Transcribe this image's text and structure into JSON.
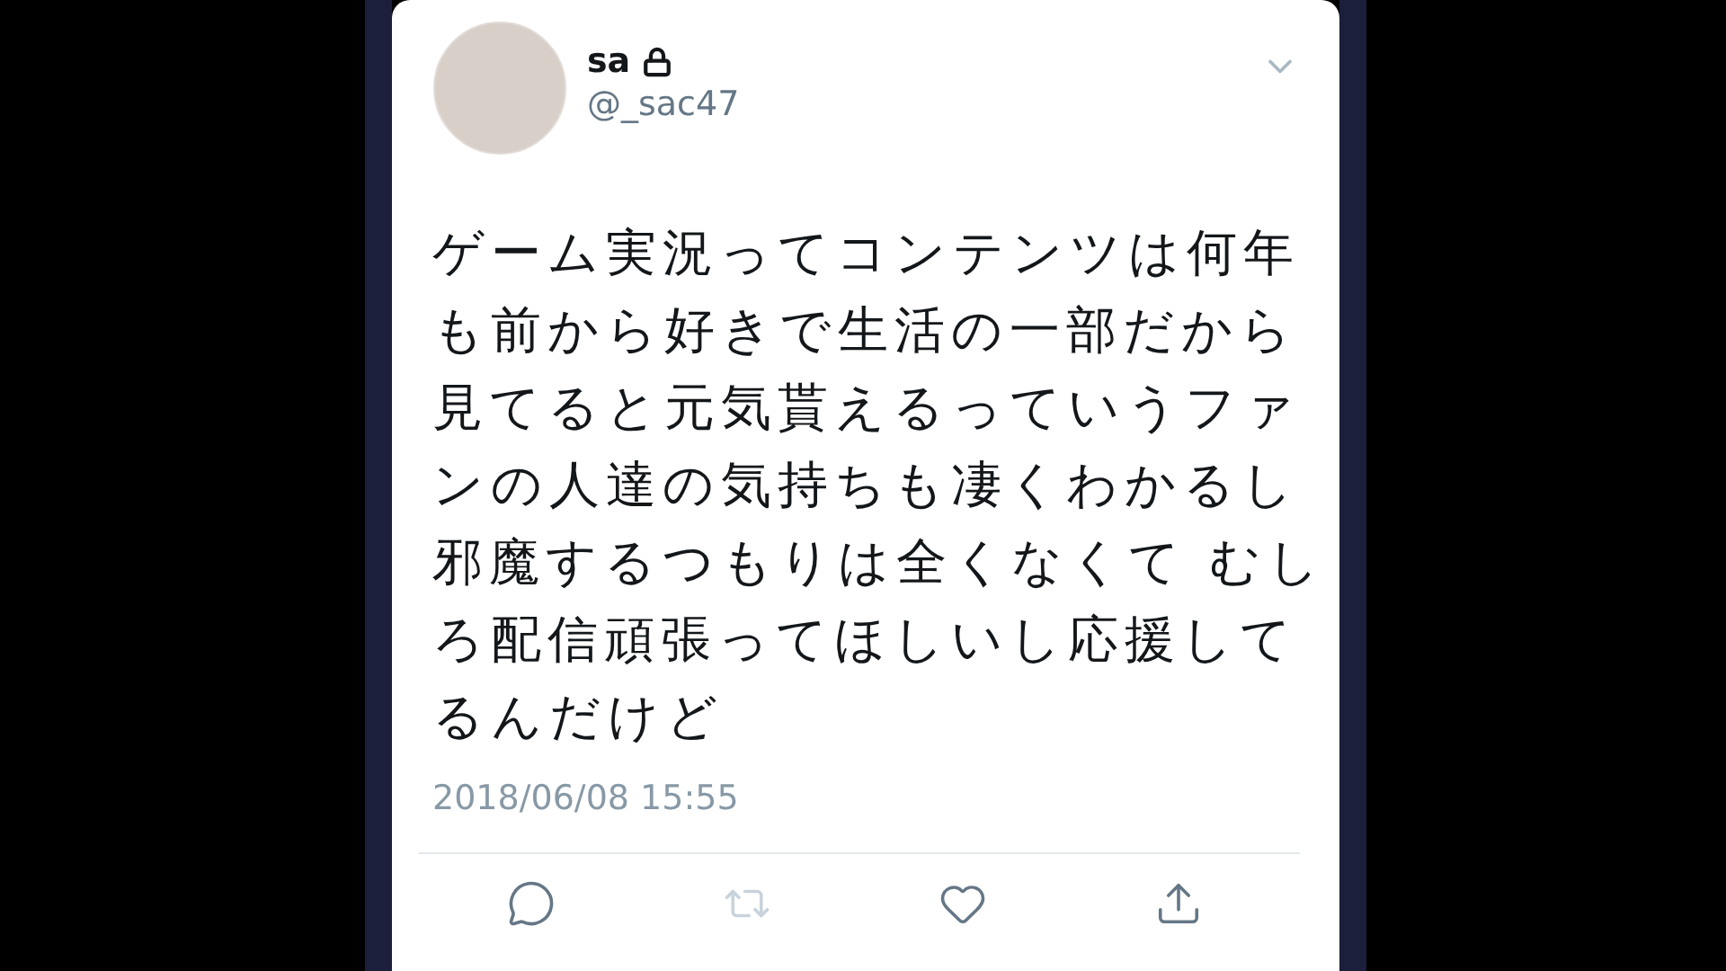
{
  "tweet": {
    "name": "sa",
    "handle": "@_sac47",
    "protected": true,
    "text": "ゲーム実況ってコンテンツは何年も前から好きで生活の一部だから見てると元気貰えるっていうファンの人達の気持ちも凄くわかるし邪魔するつもりは全くなくて むしろ配信頑張ってほしいし応援してるんだけど",
    "timestamp": "2018/06/08 15:55",
    "actions": [
      {
        "kind": "reply",
        "disabled": false
      },
      {
        "kind": "retweet",
        "disabled": true
      },
      {
        "kind": "like",
        "disabled": false
      },
      {
        "kind": "share",
        "disabled": false
      }
    ]
  }
}
